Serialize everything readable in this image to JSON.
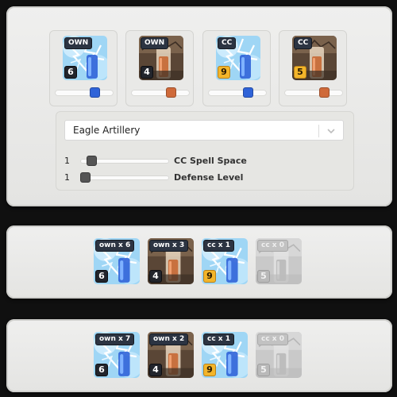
{
  "spell_cards": [
    {
      "tag": "OWN",
      "level": "6",
      "spell": "lightning-spell",
      "level_style": "dark",
      "slider_fraction": 0.72,
      "knob_color": "#2f63d8"
    },
    {
      "tag": "OWN",
      "level": "4",
      "spell": "earthquake-spell",
      "level_style": "dark",
      "slider_fraction": 0.72,
      "knob_color": "#cf6a3a"
    },
    {
      "tag": "CC",
      "level": "9",
      "spell": "lightning-spell",
      "level_style": "gold",
      "slider_fraction": 0.72,
      "knob_color": "#2f63d8"
    },
    {
      "tag": "CC",
      "level": "5",
      "spell": "earthquake-spell",
      "level_style": "gold",
      "slider_fraction": 0.72,
      "knob_color": "#cf6a3a"
    }
  ],
  "defense": {
    "selected": "Eagle Artillery",
    "sliders": [
      {
        "value": "1",
        "label": "CC Spell Space",
        "fraction": 0.08
      },
      {
        "value": "1",
        "label": "Defense Level",
        "fraction": 0.0
      }
    ]
  },
  "combos": [
    [
      {
        "tag": "own x 6",
        "level": "6",
        "spell": "lightning-spell",
        "level_style": "dark"
      },
      {
        "tag": "own x 3",
        "level": "4",
        "spell": "earthquake-spell",
        "level_style": "dark"
      },
      {
        "tag": "cc x 1",
        "level": "9",
        "spell": "lightning-spell",
        "level_style": "gold"
      },
      {
        "tag": "cc x 0",
        "level": "5",
        "spell": "earthquake-spell",
        "level_style": "grey"
      }
    ],
    [
      {
        "tag": "own x 7",
        "level": "6",
        "spell": "lightning-spell",
        "level_style": "dark"
      },
      {
        "tag": "own x 2",
        "level": "4",
        "spell": "earthquake-spell",
        "level_style": "dark"
      },
      {
        "tag": "cc x 1",
        "level": "9",
        "spell": "lightning-spell",
        "level_style": "gold"
      },
      {
        "tag": "cc x 0",
        "level": "5",
        "spell": "earthquake-spell",
        "level_style": "grey"
      }
    ]
  ],
  "colors": {
    "lightning_blue": "#2f63d8",
    "quake_orange": "#cf6a3a",
    "gold": "#f3b52a"
  }
}
